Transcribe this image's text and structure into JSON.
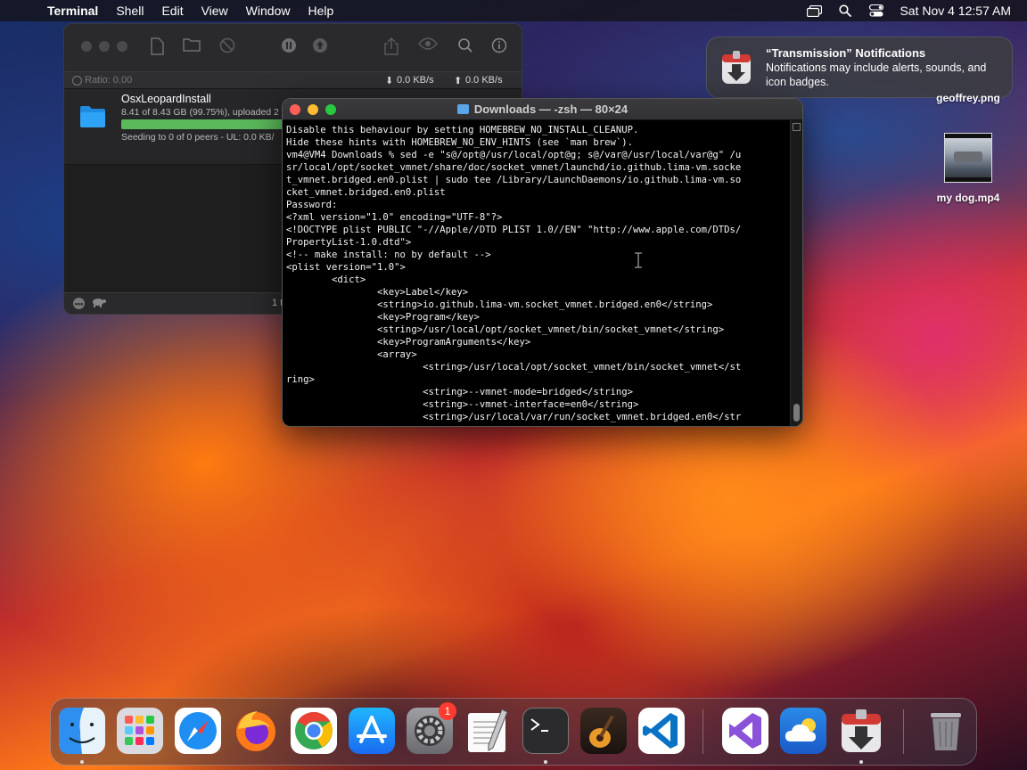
{
  "menubar": {
    "apple_glyph": "",
    "app_name": "Terminal",
    "menus": [
      "Shell",
      "Edit",
      "View",
      "Window",
      "Help"
    ],
    "clock": "Sat Nov 4  12:57 AM"
  },
  "notification": {
    "title": "“Transmission” Notifications",
    "body": "Notifications may include alerts, sounds, and icon badges."
  },
  "desktop": {
    "file1": "geoffrey.png",
    "file2": "my dog.mp4"
  },
  "transmission": {
    "ratio": "Ratio: 0.00",
    "down_rate": "0.0 KB/s",
    "up_rate": "0.0 KB/s",
    "torrent_name": "OsxLeopardInstall",
    "progress_text": "8.41 of 8.43 GB (99.75%), uploaded 2",
    "progress_fraction": 0.9975,
    "status_text": "Seeding to 0 of 0 peers - UL: 0.0 KB/",
    "bottom_text": "1 t"
  },
  "terminal": {
    "title": "Downloads — -zsh — 80×24",
    "lines": [
      "Disable this behaviour by setting HOMEBREW_NO_INSTALL_CLEANUP.",
      "Hide these hints with HOMEBREW_NO_ENV_HINTS (see `man brew`).",
      "vm4@VM4 Downloads % sed -e \"s@/opt@/usr/local/opt@g; s@/var@/usr/local/var@g\" /u",
      "sr/local/opt/socket_vmnet/share/doc/socket_vmnet/launchd/io.github.lima-vm.socke",
      "t_vmnet.bridged.en0.plist | sudo tee /Library/LaunchDaemons/io.github.lima-vm.so",
      "cket_vmnet.bridged.en0.plist",
      "Password:",
      "<?xml version=\"1.0\" encoding=\"UTF-8\"?>",
      "<!DOCTYPE plist PUBLIC \"-//Apple//DTD PLIST 1.0//EN\" \"http://www.apple.com/DTDs/",
      "PropertyList-1.0.dtd\">",
      "<!-- make install: no by default -->",
      "<plist version=\"1.0\">",
      "        <dict>",
      "                <key>Label</key>",
      "                <string>io.github.lima-vm.socket_vmnet.bridged.en0</string>",
      "                <key>Program</key>",
      "                <string>/usr/local/opt/socket_vmnet/bin/socket_vmnet</string>",
      "                <key>ProgramArguments</key>",
      "                <array>",
      "                        <string>/usr/local/opt/socket_vmnet/bin/socket_vmnet</st",
      "ring>",
      "                        <string>--vmnet-mode=bridged</string>",
      "                        <string>--vmnet-interface=en0</string>",
      "                        <string>/usr/local/var/run/socket_vmnet.bridged.en0</str"
    ]
  },
  "dock": {
    "settings_badge": "1",
    "apps": [
      "finder",
      "launchpad",
      "safari",
      "firefox",
      "chrome",
      "app-store",
      "system-settings",
      "textedit",
      "terminal",
      "garageband",
      "vscode",
      "visual-studio",
      "weather",
      "transmission",
      "trash"
    ]
  },
  "colors": {
    "accent_green": "#5bb85b",
    "close_red": "#ff5f57",
    "minimize_yellow": "#febc2e",
    "zoom_green": "#28c840"
  }
}
